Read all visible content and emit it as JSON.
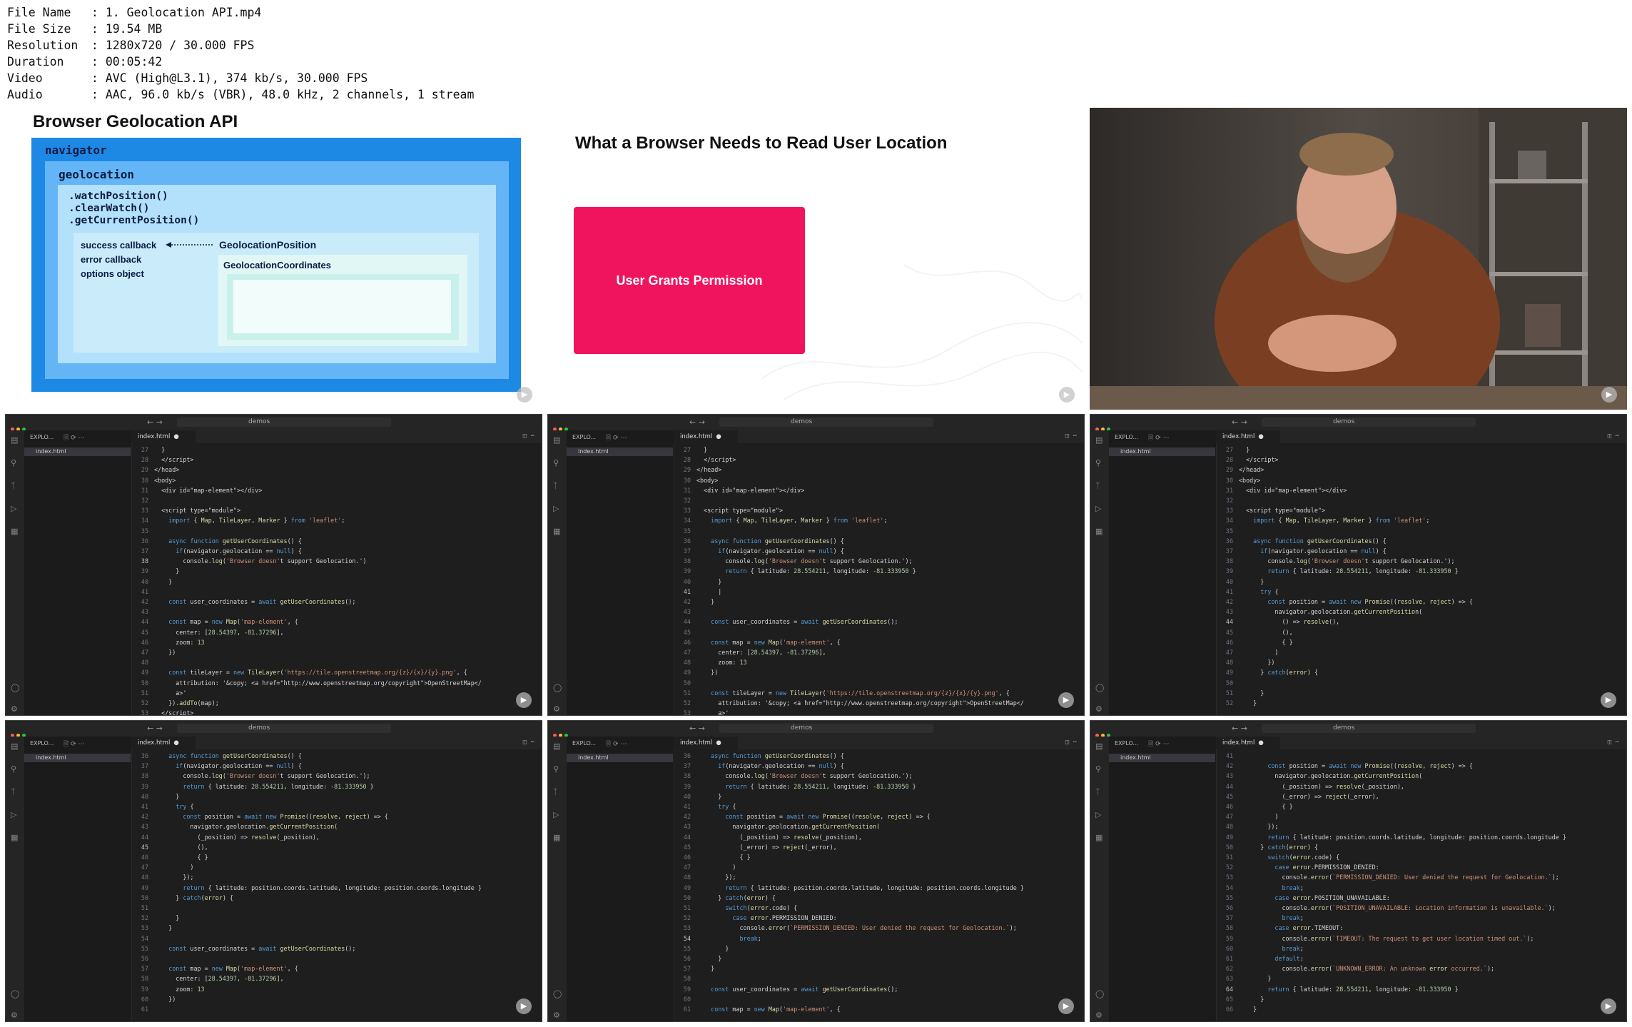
{
  "file_info": [
    {
      "key": "File Name",
      "value": "1. Geolocation API.mp4"
    },
    {
      "key": "File Size",
      "value": "19.54 MB"
    },
    {
      "key": "Resolution",
      "value": "1280x720 / 30.000 FPS"
    },
    {
      "key": "Duration",
      "value": "00:05:42"
    },
    {
      "key": "Video",
      "value": "AVC (High@L3.1), 374 kb/s, 30.000 FPS"
    },
    {
      "key": "Audio",
      "value": "AAC, 96.0 kb/s (VBR), 48.0 kHz, 2 channels, 1 stream"
    }
  ],
  "slide1": {
    "title": "Browser Geolocation API",
    "navigator": "navigator",
    "geolocation": "geolocation",
    "methods": [
      ".watchPosition()",
      ".clearWatch()",
      ".getCurrentPosition()"
    ],
    "params": [
      "success callback",
      "error callback",
      "options object"
    ],
    "position": "GeolocationPosition",
    "coordinates": "GeolocationCoordinates",
    "colors": {
      "outer": "#1e88e5",
      "mid": "#64b5f6",
      "inner": "#b3e0fb",
      "innermost": "#d8f4fb"
    }
  },
  "slide2": {
    "title": "What a Browser Needs to Read User Location",
    "card": "User Grants Permission",
    "card_color": "#f0145e"
  },
  "editor": {
    "search": "demos",
    "explorer": "EXPLO...",
    "file": "index.html",
    "tab": "index.html"
  }
}
